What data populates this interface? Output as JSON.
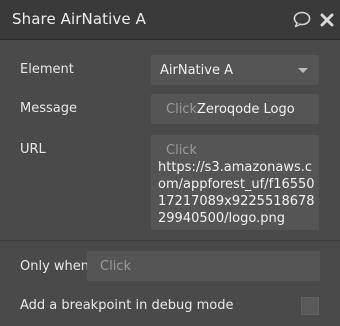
{
  "window": {
    "title": "Share AirNative A"
  },
  "icons": {
    "comment": "comment-icon",
    "close": "close-icon"
  },
  "fields": {
    "element": {
      "label": "Element",
      "value": "AirNative A"
    },
    "message": {
      "label": "Message",
      "placeholder": "Click",
      "value": "Zeroqode Logo"
    },
    "url": {
      "label": "URL",
      "placeholder": "Click",
      "value": "https://s3.amazonaws.com/appforest_uf/f1655017217089x922551867829940500/logo.png"
    },
    "only_when": {
      "label": "Only when",
      "placeholder": "Click"
    },
    "breakpoint": {
      "label": "Add a breakpoint in debug mode",
      "checked": false
    }
  },
  "colors": {
    "panel_bg": "#4a4a4a",
    "titlebar_bg": "#3a3a3a",
    "field_bg": "#555555",
    "placeholder": "#9a9a9a"
  }
}
